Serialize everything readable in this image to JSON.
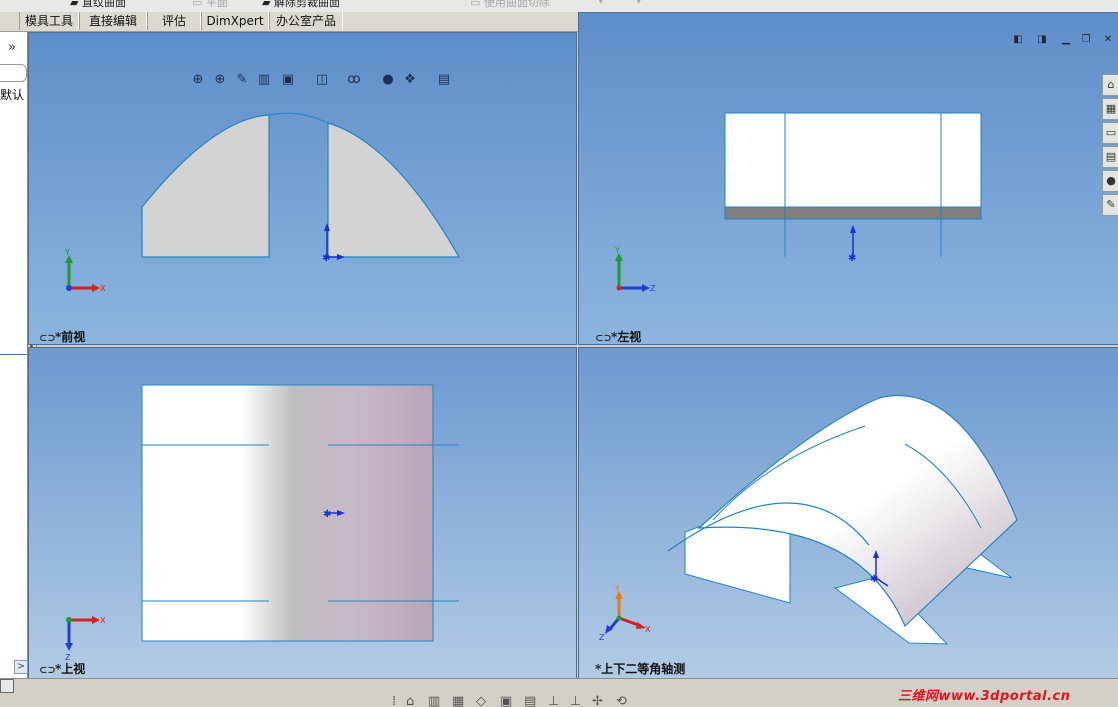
{
  "top_strip": {
    "items": [
      "直纹曲面",
      "平面",
      "解除剪裁曲面",
      "使用曲面切除"
    ]
  },
  "tabs": [
    "模具工具",
    "直接编辑",
    "评估",
    "DimXpert",
    "办公室产品"
  ],
  "left_panel": {
    "expand_glyph": "»",
    "config_label": "默认",
    "scroll_glyph": ">"
  },
  "heads_up_toolbar": {
    "icons": [
      "zoom-to-fit-icon",
      "zoom-to-area-icon",
      "previous-view-icon",
      "section-view-icon",
      "view-orientation-icon",
      "display-style-icon",
      "hide-show-items-icon",
      "edit-appearance-icon",
      "apply-scene-icon",
      "view-settings-icon"
    ]
  },
  "window_controls": {
    "icons": [
      "tile-left-icon",
      "tile-right-icon",
      "minimize-icon",
      "restore-icon",
      "close-icon"
    ]
  },
  "task_pane": {
    "icons": [
      "home-icon",
      "design-library-icon",
      "file-explorer-icon",
      "view-palette-icon",
      "appearances-icon",
      "custom-properties-icon"
    ]
  },
  "viewports": {
    "front": {
      "label": "*前视",
      "triad_x": "X",
      "triad_y": "Y"
    },
    "left": {
      "label": "*左视",
      "triad_y": "Y",
      "triad_z": "Z"
    },
    "top": {
      "label": "*上视",
      "triad_x": "X",
      "triad_z": "Z"
    },
    "iso": {
      "label": "*上下二等角轴测",
      "triad_x": "X",
      "triad_y": "Y",
      "triad_z": "Z"
    }
  },
  "watermark": "三维网www.3dportal.cn",
  "colors": {
    "model_edge": "#1f86c4",
    "triad_x": "#d62020",
    "triad_y": "#1f9a2b",
    "triad_z": "#1f3fd0",
    "origin": "#1530d8"
  }
}
